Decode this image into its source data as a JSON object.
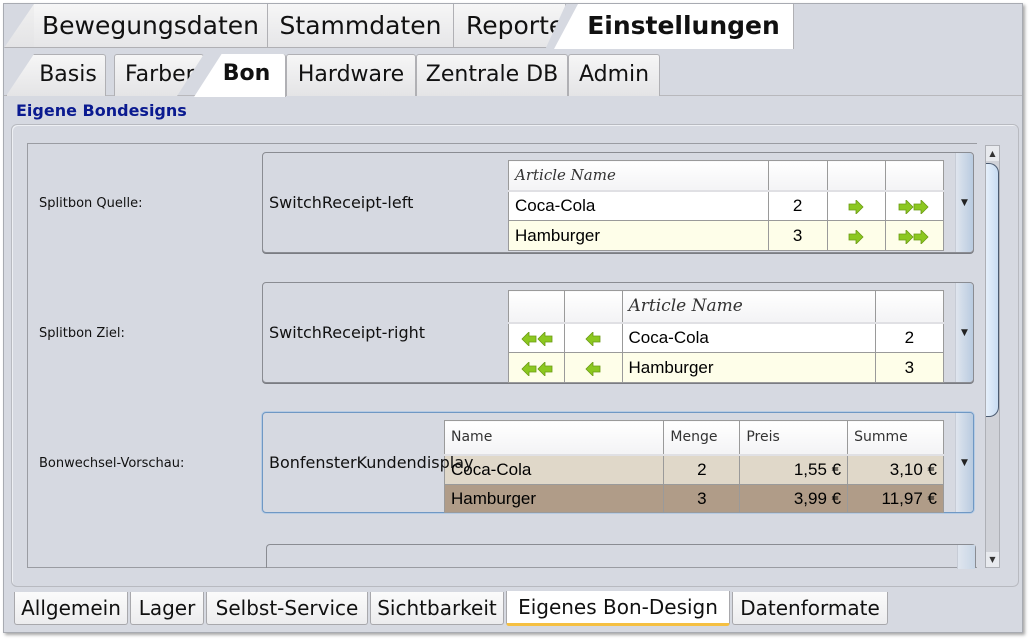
{
  "top_tabs": [
    {
      "label": "Bewegungsdaten",
      "active": false
    },
    {
      "label": "Stammdaten",
      "active": false
    },
    {
      "label": "Reporte",
      "active": false
    },
    {
      "label": "Einstellungen",
      "active": true
    }
  ],
  "sub_tabs": [
    {
      "label": "Basis",
      "active": false
    },
    {
      "label": "Farben",
      "active": false
    },
    {
      "label": "Bon",
      "active": true
    },
    {
      "label": "Hardware",
      "active": false
    },
    {
      "label": "Zentrale DB",
      "active": false
    },
    {
      "label": "Admin",
      "active": false
    }
  ],
  "section_title": "Eigene Bondesigns",
  "designs": [
    {
      "label": "Splitbon Quelle:",
      "design_name": "SwitchReceipt-left",
      "preview": {
        "header": [
          "Article Name",
          "",
          "",
          ""
        ],
        "rows": [
          {
            "name": "Coca-Cola",
            "qty": "2",
            "icon1": "arrow-right-icon",
            "icon2": "double-arrow-right-icon"
          },
          {
            "name": "Hamburger",
            "qty": "3",
            "icon1": "arrow-right-icon",
            "icon2": "double-arrow-right-icon"
          }
        ]
      }
    },
    {
      "label": "Splitbon Ziel:",
      "design_name": "SwitchReceipt-right",
      "preview": {
        "header": [
          "",
          "",
          "Article Name",
          ""
        ],
        "rows": [
          {
            "icon1": "double-arrow-left-icon",
            "icon2": "arrow-left-icon",
            "name": "Coca-Cola",
            "qty": "2"
          },
          {
            "icon1": "double-arrow-left-icon",
            "icon2": "arrow-left-icon",
            "name": "Hamburger",
            "qty": "3"
          }
        ]
      }
    },
    {
      "label": "Bonwechsel-Vorschau:",
      "design_name": "BonfensterKundendisplay",
      "preview": {
        "header": [
          "Name",
          "Menge",
          "Preis",
          "Summe"
        ],
        "rows": [
          {
            "name": "Coca-Cola",
            "qty": "2",
            "price": "1,55 €",
            "sum": "3,10 €"
          },
          {
            "name": "Hamburger",
            "qty": "3",
            "price": "3,99 €",
            "sum": "11,97 €"
          }
        ]
      }
    }
  ],
  "bottom_tabs": [
    {
      "label": "Allgemein",
      "active": false
    },
    {
      "label": "Lager",
      "active": false
    },
    {
      "label": "Selbst-Service",
      "active": false
    },
    {
      "label": "Sichtbarkeit",
      "active": false
    },
    {
      "label": "Eigenes Bon-Design",
      "active": true
    },
    {
      "label": "Datenformate",
      "active": false
    }
  ],
  "icons": {
    "dropdown": "▼",
    "scroll_up": "▲",
    "scroll_down": "▼"
  },
  "colors": {
    "section_title": "#0a1a90",
    "active_tab_underline": "#f5c042",
    "arrow_green": "#8cc820",
    "row_cream": "#fefee9",
    "row_beige": "#e0d8c9",
    "row_brown": "#b09c88"
  }
}
